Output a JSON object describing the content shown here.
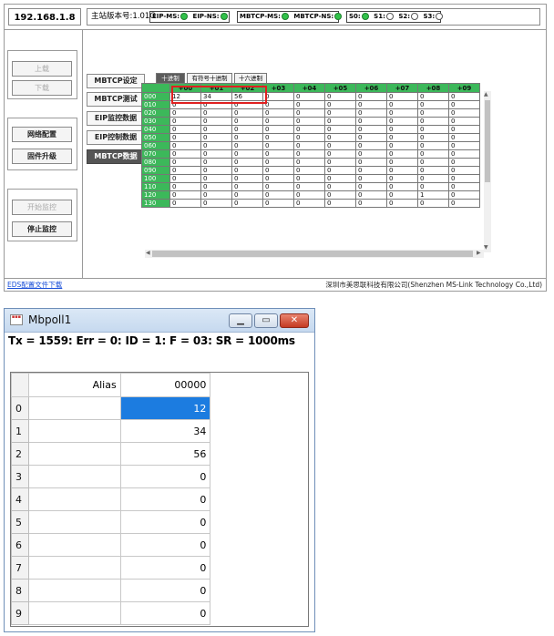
{
  "top": {
    "ip": "192.168.1.8",
    "version": "主站版本号:1.01G",
    "indicators": {
      "eip": [
        {
          "label": "EIP-MS:",
          "on": true
        },
        {
          "label": "EIP-NS:",
          "on": true
        }
      ],
      "mbtcp": [
        {
          "label": "MBTCP-MS:",
          "on": true
        },
        {
          "label": "MBTCP-NS:",
          "on": true
        }
      ],
      "slaves": [
        {
          "label": "S0:",
          "on": true
        },
        {
          "label": "S1:",
          "on": false
        },
        {
          "label": "S2:",
          "on": false
        },
        {
          "label": "S3:",
          "on": false
        }
      ]
    },
    "left_buttons": {
      "upload": "上载",
      "download": "下载",
      "network_config": "网络配置",
      "firmware_upgrade": "固件升级",
      "start_monitor": "开始监控",
      "stop_monitor": "停止监控"
    },
    "nav": [
      "MBTCP设定",
      "MBTCP测试",
      "EIP监控数据",
      "EIP控制数据",
      "MBTCP数据"
    ],
    "format_tabs": [
      "十进制",
      "有符号十进制",
      "十六进制"
    ],
    "grid": {
      "columns": [
        "+00",
        "+01",
        "+02",
        "+03",
        "+04",
        "+05",
        "+06",
        "+07",
        "+08",
        "+09"
      ],
      "rows": [
        {
          "addr": "000",
          "values": [
            "12",
            "34",
            "56",
            "0",
            "0",
            "0",
            "0",
            "0",
            "0",
            "0"
          ]
        },
        {
          "addr": "010",
          "values": [
            "0",
            "0",
            "0",
            "0",
            "0",
            "0",
            "0",
            "0",
            "0",
            "0"
          ]
        },
        {
          "addr": "020",
          "values": [
            "0",
            "0",
            "0",
            "0",
            "0",
            "0",
            "0",
            "0",
            "0",
            "0"
          ]
        },
        {
          "addr": "030",
          "values": [
            "0",
            "0",
            "0",
            "0",
            "0",
            "0",
            "0",
            "0",
            "0",
            "0"
          ]
        },
        {
          "addr": "040",
          "values": [
            "0",
            "0",
            "0",
            "0",
            "0",
            "0",
            "0",
            "0",
            "0",
            "0"
          ]
        },
        {
          "addr": "050",
          "values": [
            "0",
            "0",
            "0",
            "0",
            "0",
            "0",
            "0",
            "0",
            "0",
            "0"
          ]
        },
        {
          "addr": "060",
          "values": [
            "0",
            "0",
            "0",
            "0",
            "0",
            "0",
            "0",
            "0",
            "0",
            "0"
          ]
        },
        {
          "addr": "070",
          "values": [
            "0",
            "0",
            "0",
            "0",
            "0",
            "0",
            "0",
            "0",
            "0",
            "0"
          ]
        },
        {
          "addr": "080",
          "values": [
            "0",
            "0",
            "0",
            "0",
            "0",
            "0",
            "0",
            "0",
            "0",
            "0"
          ]
        },
        {
          "addr": "090",
          "values": [
            "0",
            "0",
            "0",
            "0",
            "0",
            "0",
            "0",
            "0",
            "0",
            "0"
          ]
        },
        {
          "addr": "100",
          "values": [
            "0",
            "0",
            "0",
            "0",
            "0",
            "0",
            "0",
            "0",
            "0",
            "0"
          ]
        },
        {
          "addr": "110",
          "values": [
            "0",
            "0",
            "0",
            "0",
            "0",
            "0",
            "0",
            "0",
            "0",
            "0"
          ]
        },
        {
          "addr": "120",
          "values": [
            "0",
            "0",
            "0",
            "0",
            "0",
            "0",
            "0",
            "0",
            "1",
            "0"
          ]
        },
        {
          "addr": "130",
          "values": [
            "0",
            "0",
            "0",
            "0",
            "0",
            "0",
            "0",
            "0",
            "0",
            "0"
          ]
        }
      ]
    },
    "footer": {
      "eds_link": "EDS配置文件下载",
      "company": "深圳市美思联科技有限公司(Shenzhen MS-Link Technology Co.,Ltd)"
    }
  },
  "mbpoll": {
    "title": "Mbpoll1",
    "icon": "mbpoll-app-icon",
    "status_line": "Tx = 1559: Err = 0: ID = 1: F = 03: SR = 1000ms",
    "alias_header": "Alias",
    "address_header": "00000",
    "rows": [
      {
        "index": "0",
        "value": "12",
        "selected": true
      },
      {
        "index": "1",
        "value": "34"
      },
      {
        "index": "2",
        "value": "56"
      },
      {
        "index": "3",
        "value": "0"
      },
      {
        "index": "4",
        "value": "0"
      },
      {
        "index": "5",
        "value": "0"
      },
      {
        "index": "6",
        "value": "0"
      },
      {
        "index": "7",
        "value": "0"
      },
      {
        "index": "8",
        "value": "0"
      },
      {
        "index": "9",
        "value": "0"
      }
    ]
  },
  "colors": {
    "grid_header_green": "#3cb85a",
    "led_on": "#31c24a",
    "highlight_red": "#e02020",
    "selection_blue": "#1c7ce0",
    "link_blue": "#1a4fd8"
  }
}
